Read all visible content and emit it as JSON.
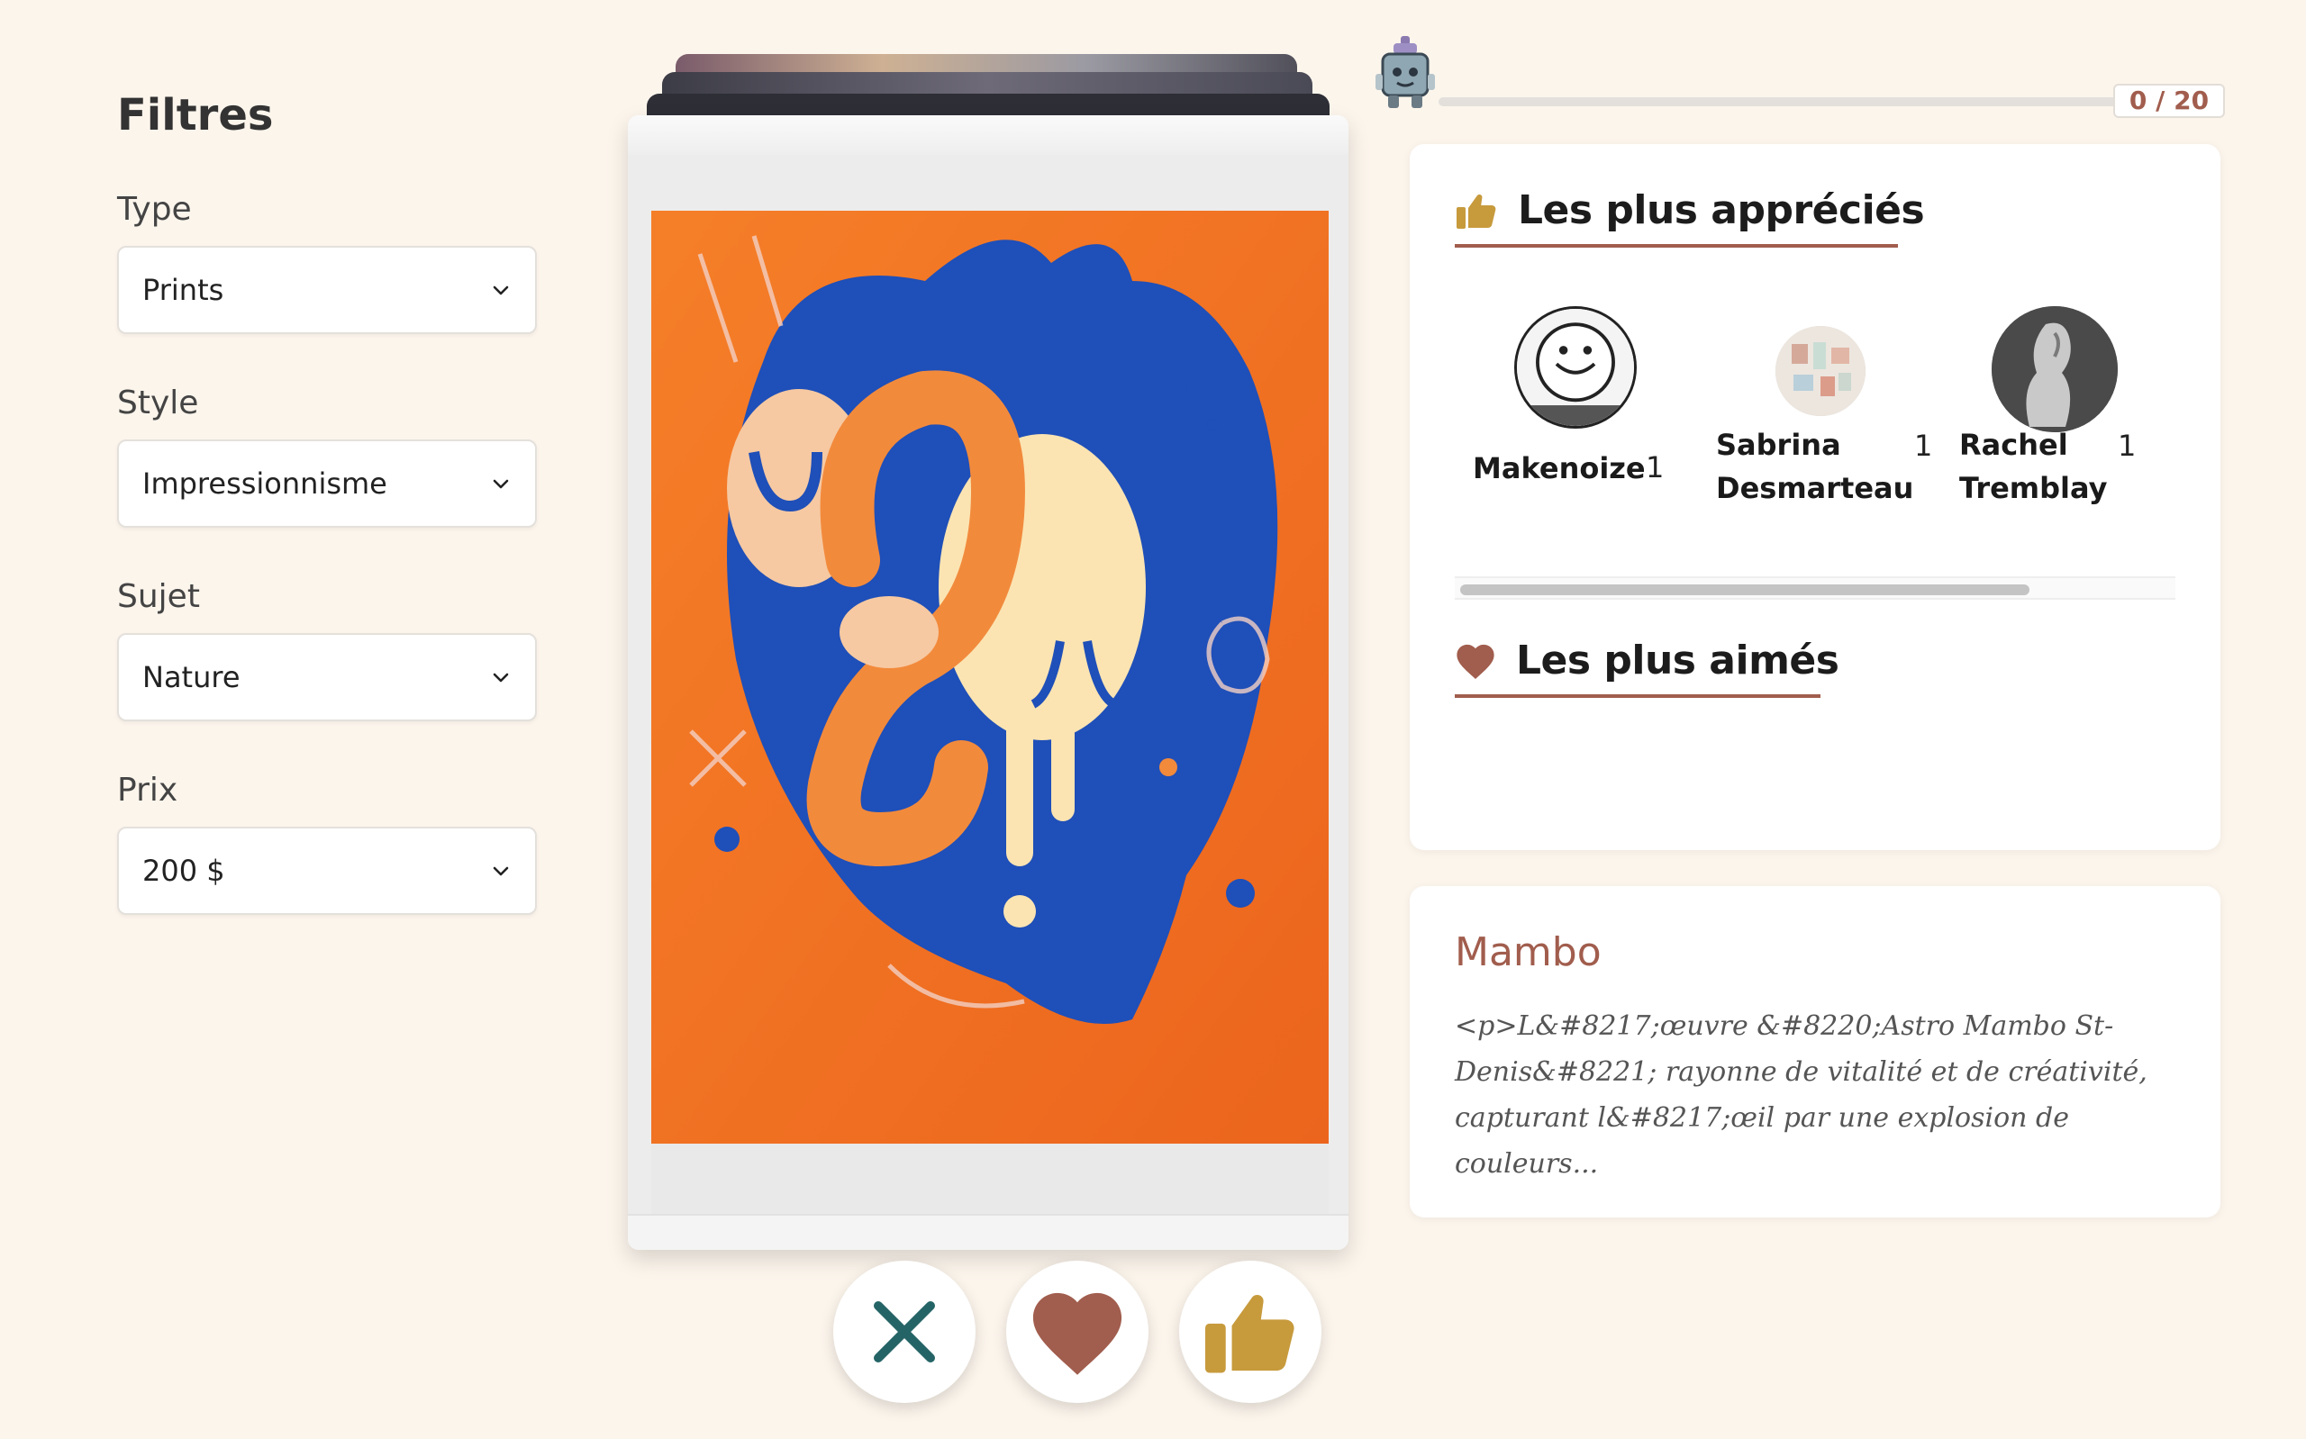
{
  "filters": {
    "title": "Filtres",
    "groups": [
      {
        "label": "Type",
        "value": "Prints"
      },
      {
        "label": "Style",
        "value": "Impressionnisme"
      },
      {
        "label": "Sujet",
        "value": "Nature"
      },
      {
        "label": "Prix",
        "value": "200 $"
      }
    ]
  },
  "progress": {
    "counter": "0 / 20",
    "fraction": 0.0
  },
  "most_liked": {
    "title": "Les plus appréciés",
    "artists": [
      {
        "name": "Makenoize",
        "count": "1"
      },
      {
        "name": "Sabrina Desmarteau",
        "count": "1"
      },
      {
        "name": "Rachel Tremblay",
        "count": "1"
      }
    ]
  },
  "most_loved": {
    "title": "Les plus aimés"
  },
  "artwork": {
    "title": "Mambo",
    "description": "<p>L&#8217;œuvre &#8220;Astro Mambo St-Denis&#8221; rayonne de vitalité et de créativité, capturant l&#8217;œil par une explosion de couleurs..."
  },
  "icons": {
    "dismiss": "close-icon",
    "love": "heart-icon",
    "like": "thumbs-up-icon",
    "select": "chevron-down-icon",
    "mascot": "robot-icon"
  },
  "colors": {
    "background": "#fcf5ec",
    "accent": "#a15d4d",
    "dismiss": "#256466",
    "like": "#c79a3c"
  }
}
